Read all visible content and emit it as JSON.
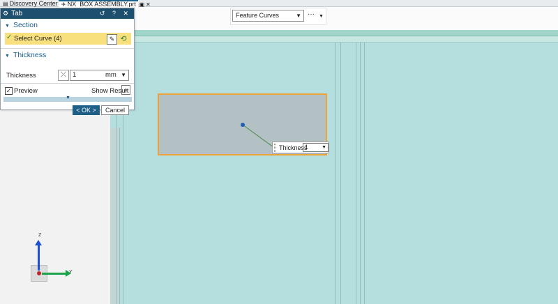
{
  "tabs": [
    {
      "label": "Discovery Center",
      "icon": "document-icon"
    },
    {
      "label": "NX_BOX ASSEMBLY.prt",
      "icon": "part-icon",
      "active": true
    }
  ],
  "toolbar": {
    "filter_value": "Feature Curves",
    "more": "···"
  },
  "dialog": {
    "title": "Tab",
    "controls": "↺ ? ✕",
    "section_group": "Section",
    "select_curve": "Select Curve (4)",
    "thickness_group": "Thickness",
    "thickness_label": "Thickness",
    "thickness_value": "1",
    "thickness_unit": "mm",
    "preview_label": "Preview",
    "preview_checked": true,
    "show_result": "Show Result",
    "ok": "< OK >",
    "cancel": "Cancel"
  },
  "onscreen": {
    "label": "Thickness",
    "value": "1"
  },
  "triad": {
    "z": "Z",
    "y": "Y"
  },
  "colors": {
    "title_bar": "#1e4f6e",
    "selection_highlight": "#f7e07d",
    "model_face": "#b5dfdf",
    "selected_edge": "#f0a23a"
  }
}
